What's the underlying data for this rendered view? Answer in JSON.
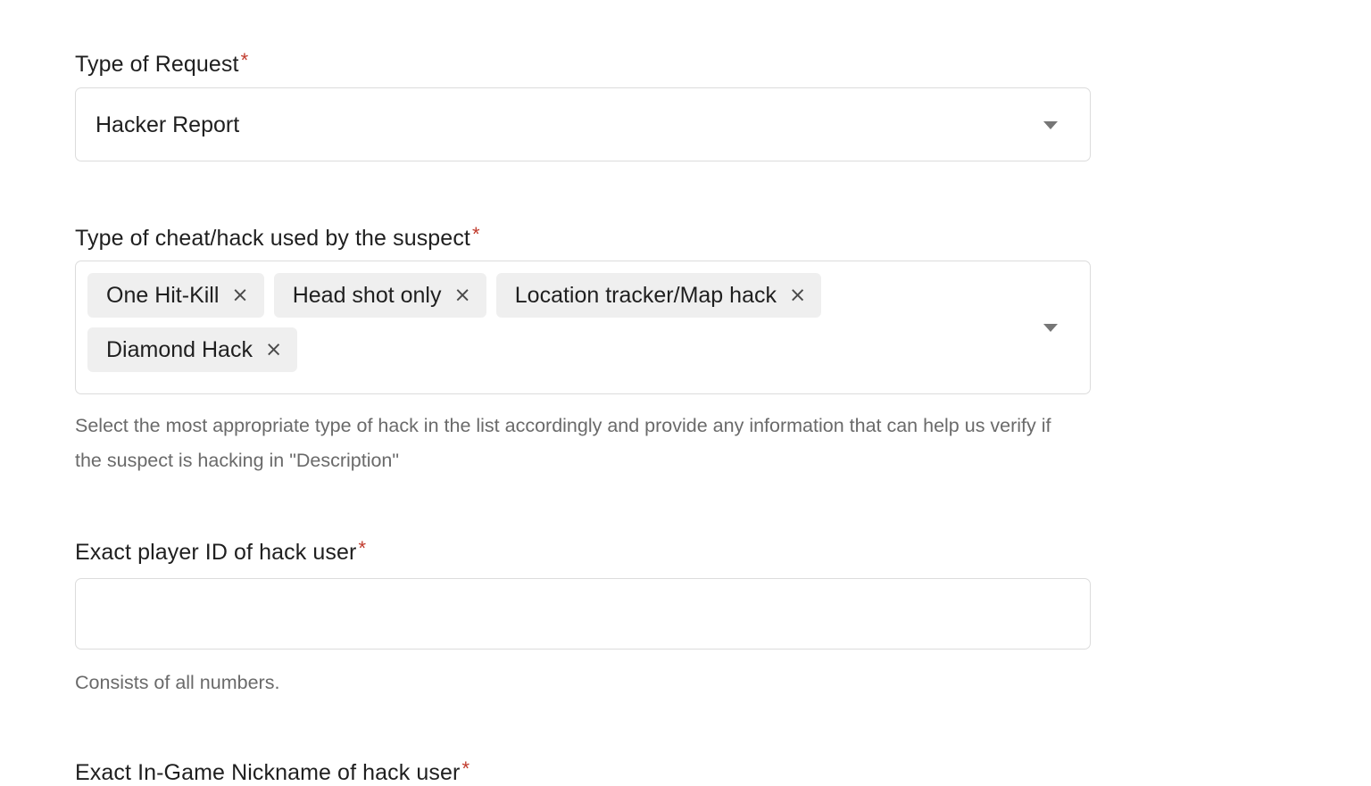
{
  "form": {
    "fields": [
      {
        "id": "type_of_request",
        "label": "Type of Request",
        "required_marker": "*",
        "control": "select",
        "value": "Hacker Report",
        "caret_icon": "chevron-down-icon"
      },
      {
        "id": "cheat_type",
        "label": "Type of cheat/hack used by the suspect",
        "required_marker": "*",
        "control": "multiselect",
        "chips": [
          {
            "label": "One Hit-Kill",
            "remove_icon": "×"
          },
          {
            "label": "Head shot only",
            "remove_icon": "×"
          },
          {
            "label": "Location tracker/Map hack",
            "remove_icon": "×"
          },
          {
            "label": "Diamond Hack",
            "remove_icon": "×"
          }
        ],
        "caret_icon": "chevron-down-icon",
        "helper": "Select the most appropriate type of hack in the list accordingly and provide any information that can help us verify if the suspect is hacking in \"Description\""
      },
      {
        "id": "player_id",
        "label": "Exact player ID of hack user",
        "required_marker": "*",
        "control": "text",
        "value": "",
        "placeholder": "",
        "helper": "Consists of all numbers."
      },
      {
        "id": "nickname",
        "label": "Exact In-Game Nickname of hack user",
        "required_marker": "*",
        "control": "text"
      }
    ]
  },
  "colors": {
    "required_star": "#c0392b",
    "border": "#dcdcdc",
    "chip_background": "#efefef",
    "helper_text": "#6a6a6a",
    "label_text": "#1f1f1f",
    "caret": "#767676",
    "page_background": "#ffffff"
  }
}
